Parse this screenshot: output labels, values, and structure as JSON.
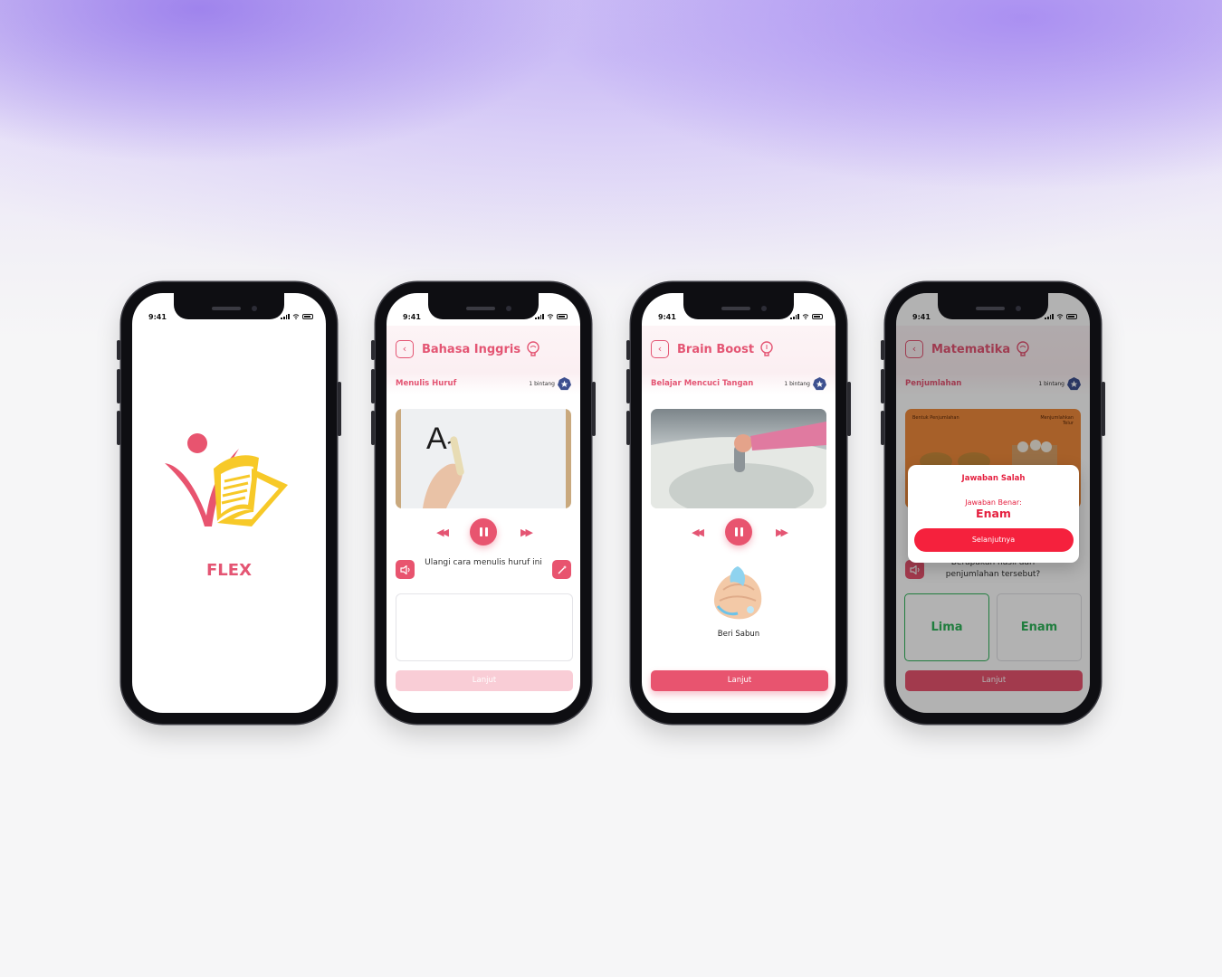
{
  "status_time": "9:41",
  "phone1": {
    "app_name": "FLEX"
  },
  "phone2": {
    "header_title": "Bahasa Inggris",
    "lesson_title": "Menulis Huruf",
    "stars_label": "1 bintang",
    "instruction": "Ulangi cara menulis huruf ini",
    "button_label": "Lanjut",
    "video_letter": "A"
  },
  "phone3": {
    "header_title": "Brain Boost",
    "lesson_title": "Belajar Mencuci Tangan",
    "stars_label": "1 bintang",
    "step_label": "Beri Sabun",
    "button_label": "Lanjut"
  },
  "phone4": {
    "header_title": "Matematika",
    "lesson_title": "Penjumlahan",
    "stars_label": "1 bintang",
    "video_caption_left": "Bentuk Penjumlahan",
    "video_caption_right": "Menjumlahkan Telur",
    "question": "Berapakah hasil dari penjumlahan tersebut?",
    "choices": [
      "Lima",
      "Enam"
    ],
    "button_label": "Lanjut",
    "modal": {
      "title": "Jawaban Salah",
      "subtitle": "Jawaban Benar:",
      "answer": "Enam",
      "button_label": "Selanjutnya"
    }
  },
  "colors": {
    "primary": "#e8546f",
    "error": "#f5213d",
    "correct": "#2fb35a",
    "logo_yellow": "#f7c928"
  }
}
